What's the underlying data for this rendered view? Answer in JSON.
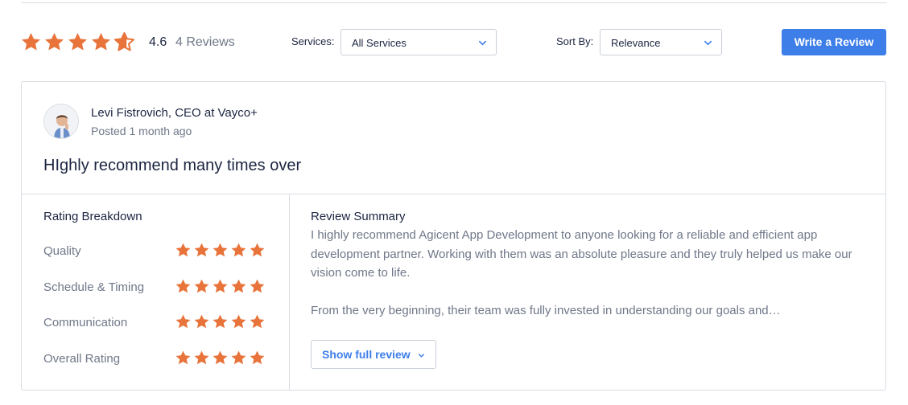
{
  "summary": {
    "overall_score": "4.6",
    "overall_rating_value": 4.6,
    "review_count_label": "4 Reviews",
    "star_color": "#e8743b"
  },
  "filters": {
    "services_label": "Services:",
    "services_value": "All Services",
    "sort_label": "Sort By:",
    "sort_value": "Relevance"
  },
  "actions": {
    "write_review_label": "Write a Review",
    "accent_color": "#3d7ee8"
  },
  "review": {
    "reviewer": "Levi Fistrovich, CEO at Vayco+",
    "posted": "Posted 1 month ago",
    "title": "HIghly recommend many times over",
    "breakdown_heading": "Rating Breakdown",
    "breakdown": [
      {
        "label": "Quality",
        "rating": 5
      },
      {
        "label": "Schedule & Timing",
        "rating": 5
      },
      {
        "label": "Communication",
        "rating": 5
      },
      {
        "label": "Overall Rating",
        "rating": 5
      }
    ],
    "summary_heading": "Review Summary",
    "summary_paragraphs": [
      "I highly recommend Agicent App Development to anyone looking for a reliable and efficient app development partner. Working with them was an absolute pleasure and they truly helped us make our vision come to life.",
      "From the very beginning, their team was fully invested in understanding our goals and…"
    ],
    "show_full_label": "Show full review"
  },
  "icons": {
    "star": "star-icon",
    "half_star": "half-star-icon",
    "chevron": "chevron-down-icon",
    "avatar": "avatar"
  }
}
